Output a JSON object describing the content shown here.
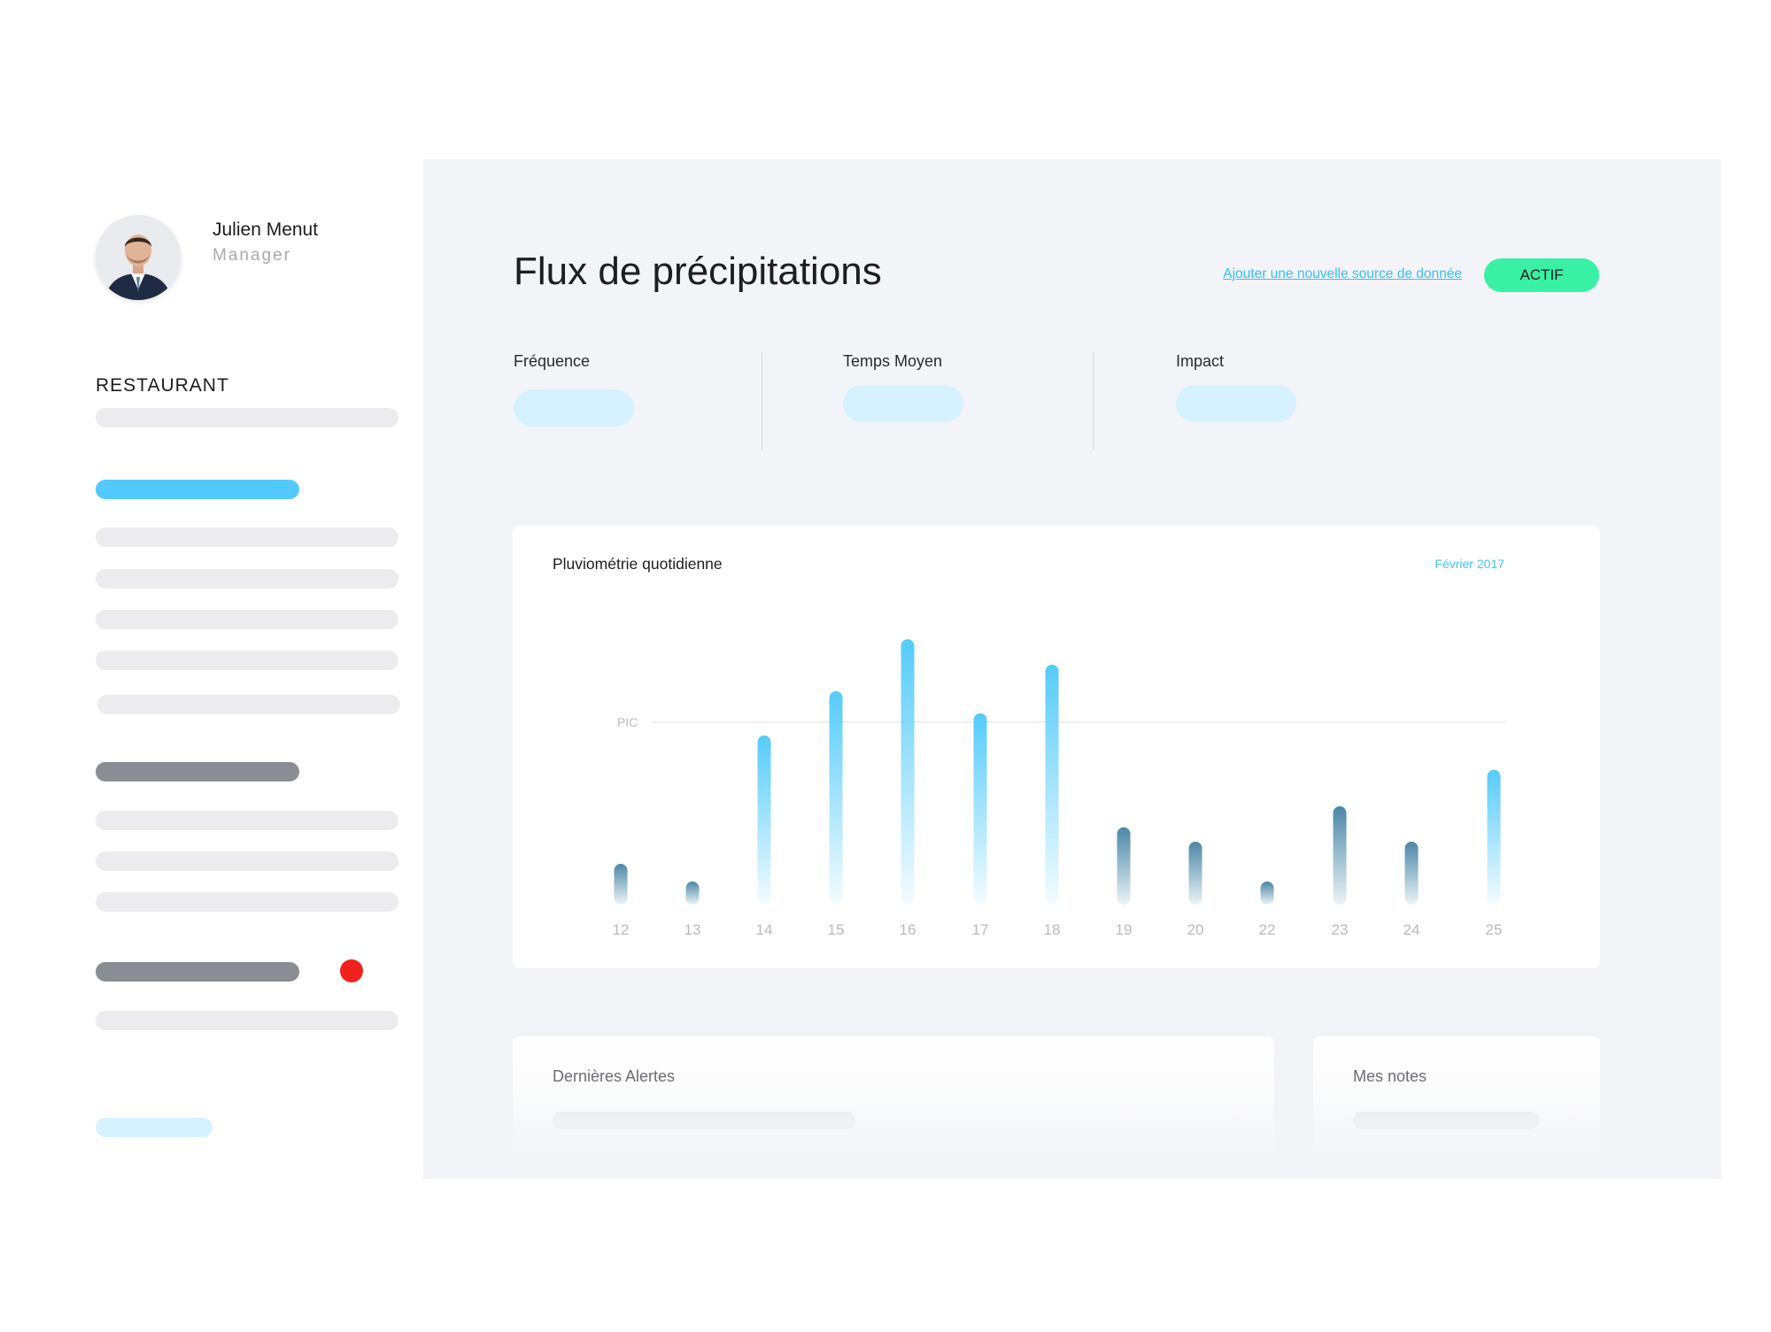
{
  "user": {
    "name": "Julien Menut",
    "role": "Manager"
  },
  "sidebar": {
    "section_title": "RESTAURANT"
  },
  "header": {
    "title": "Flux de précipitations",
    "add_source_link": "Ajouter une nouvelle source de donnée",
    "status_button": "ACTIF"
  },
  "kpis": [
    {
      "label": "Fréquence"
    },
    {
      "label": "Temps Moyen"
    },
    {
      "label": "Impact"
    }
  ],
  "chart_card": {
    "title": "Pluviométrie quotidienne",
    "period": "Février 2017"
  },
  "chart_data": {
    "type": "bar",
    "title": "Pluviométrie quotidienne",
    "subtitle": "Février 2017",
    "categories": [
      "12",
      "13",
      "14",
      "15",
      "16",
      "17",
      "18",
      "19",
      "20",
      "22",
      "23",
      "24",
      "25"
    ],
    "values": [
      32,
      16,
      148,
      188,
      235,
      168,
      212,
      65,
      52,
      16,
      84,
      52,
      117
    ],
    "ylim": [
      0,
      240
    ],
    "reference_line": {
      "label": "PIC",
      "value": 160
    },
    "highlight": {
      "above_reference": "#55cbfa",
      "below_reference": "#4a87a6"
    },
    "grid": false
  },
  "bottom": {
    "alerts_title": "Dernières Alertes",
    "notes_title": "Mes notes"
  },
  "colors": {
    "accent": "#53c9fb",
    "status": "#39f1a4",
    "notification": "#f1211b",
    "panel": "#f3f4f7"
  }
}
